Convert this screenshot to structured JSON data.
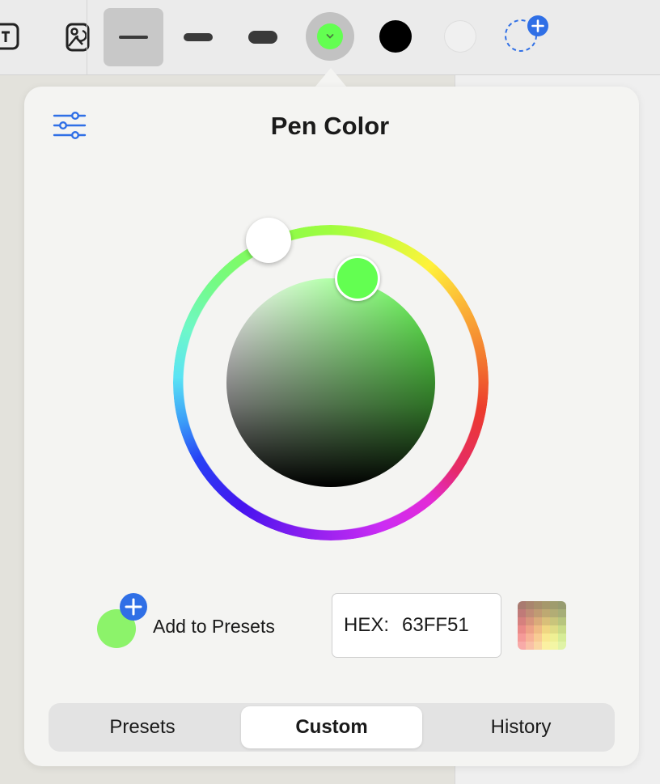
{
  "toolbar": {
    "icons": [
      "text-box-icon",
      "image-sticker-icon"
    ],
    "line_widths": [
      "thin",
      "medium",
      "thick"
    ],
    "selected_width": "thin",
    "current_color": "#63ff51",
    "swatches": [
      "#000000",
      "#f0f0f0"
    ],
    "add_swatch_icon": "dashed-circle-plus-icon"
  },
  "popover": {
    "title": "Pen Color",
    "settings_icon": "sliders-icon",
    "wheel": {
      "selected_color": "#63ff51",
      "hue_handle_color": "#ffffff"
    },
    "add_to_presets": {
      "label": "Add to Presets",
      "icon": "plus-circle-icon",
      "swatch_color": "#8cf36a"
    },
    "hex": {
      "label": "HEX:",
      "value": "63FF51"
    },
    "grid_picker_icon": "color-grid-icon",
    "tabs": [
      {
        "label": "Presets",
        "active": false
      },
      {
        "label": "Custom",
        "active": true
      },
      {
        "label": "History",
        "active": false
      }
    ]
  },
  "colors": {
    "accent_blue": "#2f6fe6",
    "popover_bg": "#f4f4f2",
    "toolbar_bg": "#ebebeb"
  }
}
